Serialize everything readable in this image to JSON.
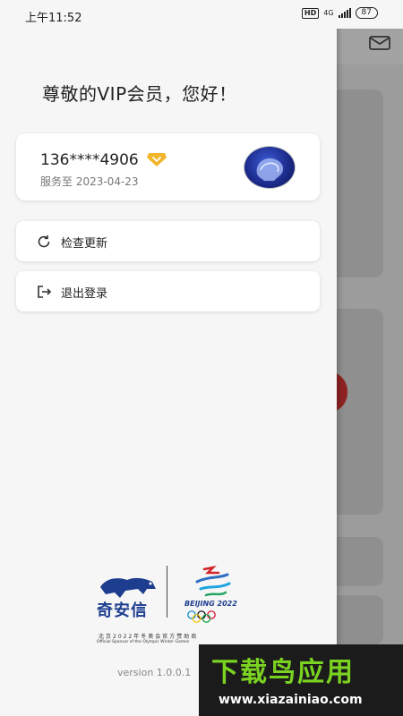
{
  "status_bar": {
    "time": "上午11:52",
    "hd": "HD",
    "network": "4G",
    "battery": "87"
  },
  "drawer": {
    "greeting": "尊敬的VIP会员，您好！",
    "account": {
      "phone": "136****4906",
      "service_until": "服务至 2023-04-23"
    },
    "menu": [
      {
        "label": "检查更新",
        "icon": "refresh-icon"
      },
      {
        "label": "退出登录",
        "icon": "logout-icon"
      }
    ],
    "sponsor": {
      "brand": "奇安信",
      "games_logo_text": "BEIJING 2022",
      "sponsor_cn": "北京2022年冬奥会官方赞助商",
      "sponsor_en": "Official Sponsor of the Olympic Winter Games"
    },
    "version": "version 1.0.0.1"
  },
  "watermark": {
    "title": "下载鸟应用",
    "url": "www.xiazainiao.com"
  },
  "colors": {
    "drawer_bg": "#f6f6f6",
    "vip_gold": "#f2b52b",
    "brand_blue": "#1d3d8f",
    "watermark_green": "#7bd321"
  }
}
